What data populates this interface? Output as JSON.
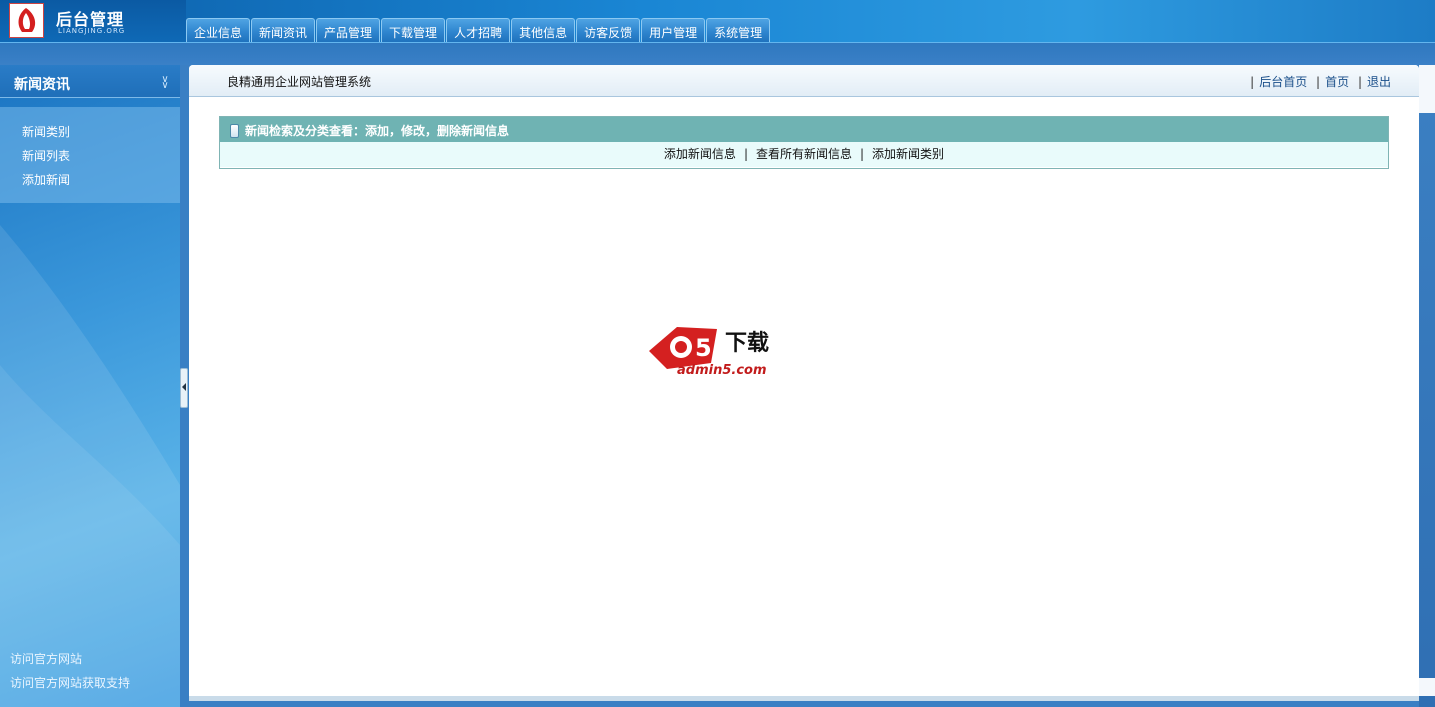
{
  "header": {
    "logo_title": "后台管理",
    "logo_sub": "LIANGJING.ORG",
    "tabs": [
      {
        "label": "企业信息"
      },
      {
        "label": "新闻资讯"
      },
      {
        "label": "产品管理"
      },
      {
        "label": "下载管理"
      },
      {
        "label": "人才招聘"
      },
      {
        "label": "其他信息"
      },
      {
        "label": "访客反馈"
      },
      {
        "label": "用户管理"
      },
      {
        "label": "系统管理"
      }
    ]
  },
  "sidebar": {
    "title": "新闻资讯",
    "items": [
      {
        "label": "新闻类别"
      },
      {
        "label": "新闻列表"
      },
      {
        "label": "添加新闻"
      }
    ],
    "footer": [
      {
        "label": "访问官方网站"
      },
      {
        "label": "访问官方网站获取支持"
      }
    ]
  },
  "main": {
    "system_title": "良精通用企业网站管理系统",
    "links": [
      {
        "label": "后台首页"
      },
      {
        "label": "首页"
      },
      {
        "label": "退出"
      }
    ],
    "panel": {
      "title": "新闻检索及分类查看：添加，修改，删除新闻信息",
      "actions": [
        {
          "label": "添加新闻信息"
        },
        {
          "label": "查看所有新闻信息"
        },
        {
          "label": "添加新闻类别"
        }
      ]
    },
    "watermark": {
      "text": "下载",
      "url": "admin5.com"
    }
  },
  "colors": {
    "header_blue": "#1a86d4",
    "panel_teal": "#6fb3b3",
    "panel_body": "#e9fbfb",
    "watermark_red": "#c21c1c"
  }
}
